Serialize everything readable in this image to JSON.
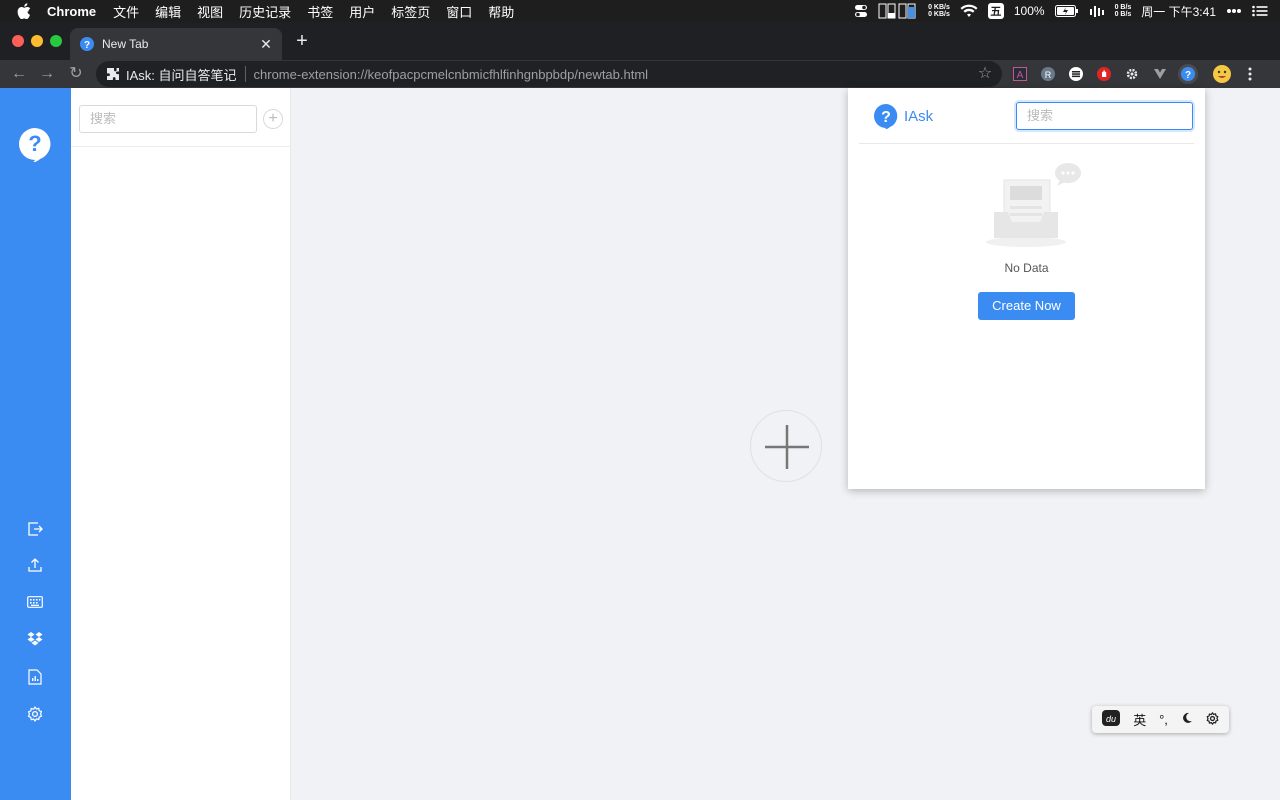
{
  "menubar": {
    "app_name": "Chrome",
    "items": [
      "文件",
      "编辑",
      "视图",
      "历史记录",
      "书签",
      "用户",
      "标签页",
      "窗口",
      "帮助"
    ],
    "net_up": "0 KB/s",
    "net_down": "0 KB/s",
    "battery": "100%",
    "net2_up": "0 B/s",
    "net2_down": "0 B/s",
    "ime_label": "五",
    "clock": "周一 下午3:41"
  },
  "tab": {
    "title": "New Tab"
  },
  "omnibox": {
    "site_name": "IAsk: 自问自答笔记",
    "url": "chrome-extension://keofpacpcmelcnbmicfhlfinhgnbpbdp/newtab.html"
  },
  "notelist": {
    "search_placeholder": "搜索"
  },
  "popup": {
    "brand": "IAsk",
    "search_placeholder": "搜索",
    "empty_text": "No Data",
    "create_label": "Create Now"
  },
  "ime": {
    "lang": "英",
    "punct": "°,"
  },
  "colors": {
    "accent": "#3b8cf2",
    "sidebar": "#3b8cf2"
  }
}
